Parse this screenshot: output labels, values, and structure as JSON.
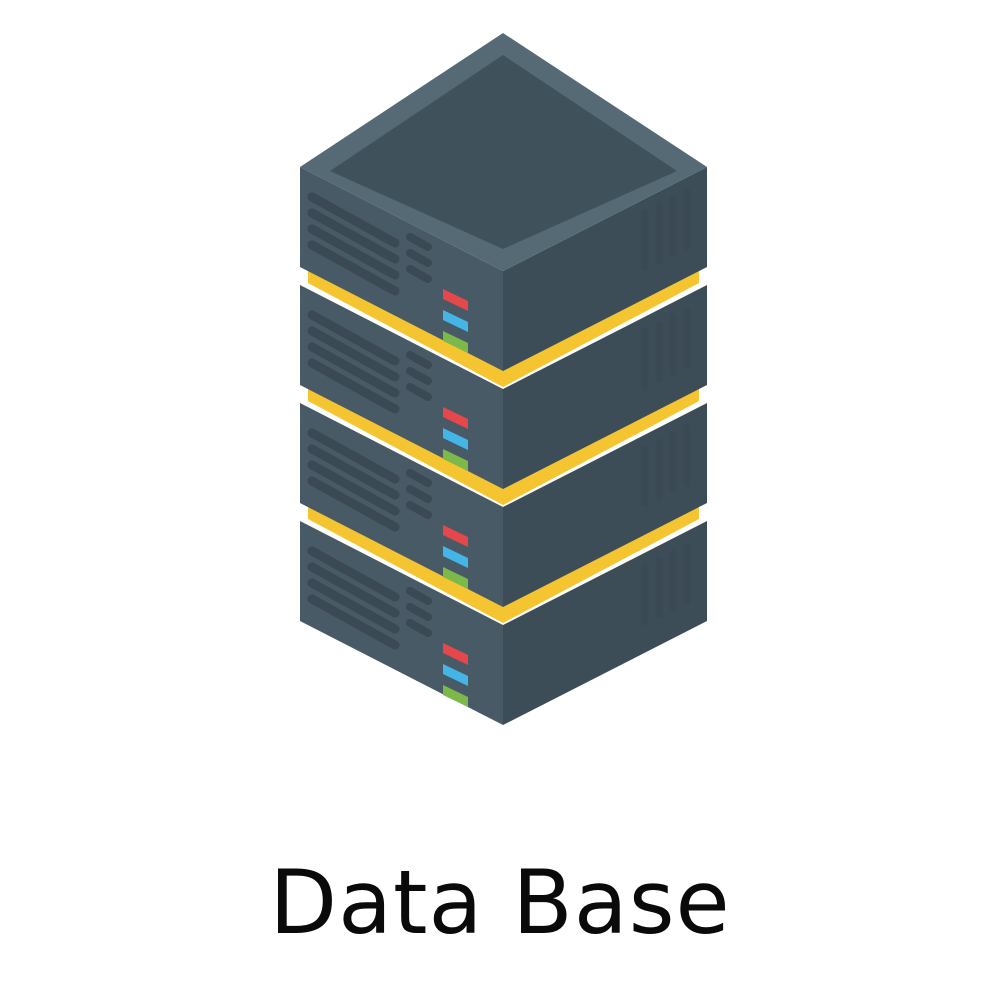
{
  "caption": "Data Base",
  "icon": "database-server-stack-icon",
  "colors": {
    "body": "#485a66",
    "body_dark": "#3d4d58",
    "top_face": "#3f525c",
    "rim": "#566a76",
    "vent": "#3a4953",
    "separator": "#f4c431",
    "led_red": "#e5474b",
    "led_blue": "#45b5e8",
    "led_green": "#7cb94a"
  },
  "server_units": 4
}
